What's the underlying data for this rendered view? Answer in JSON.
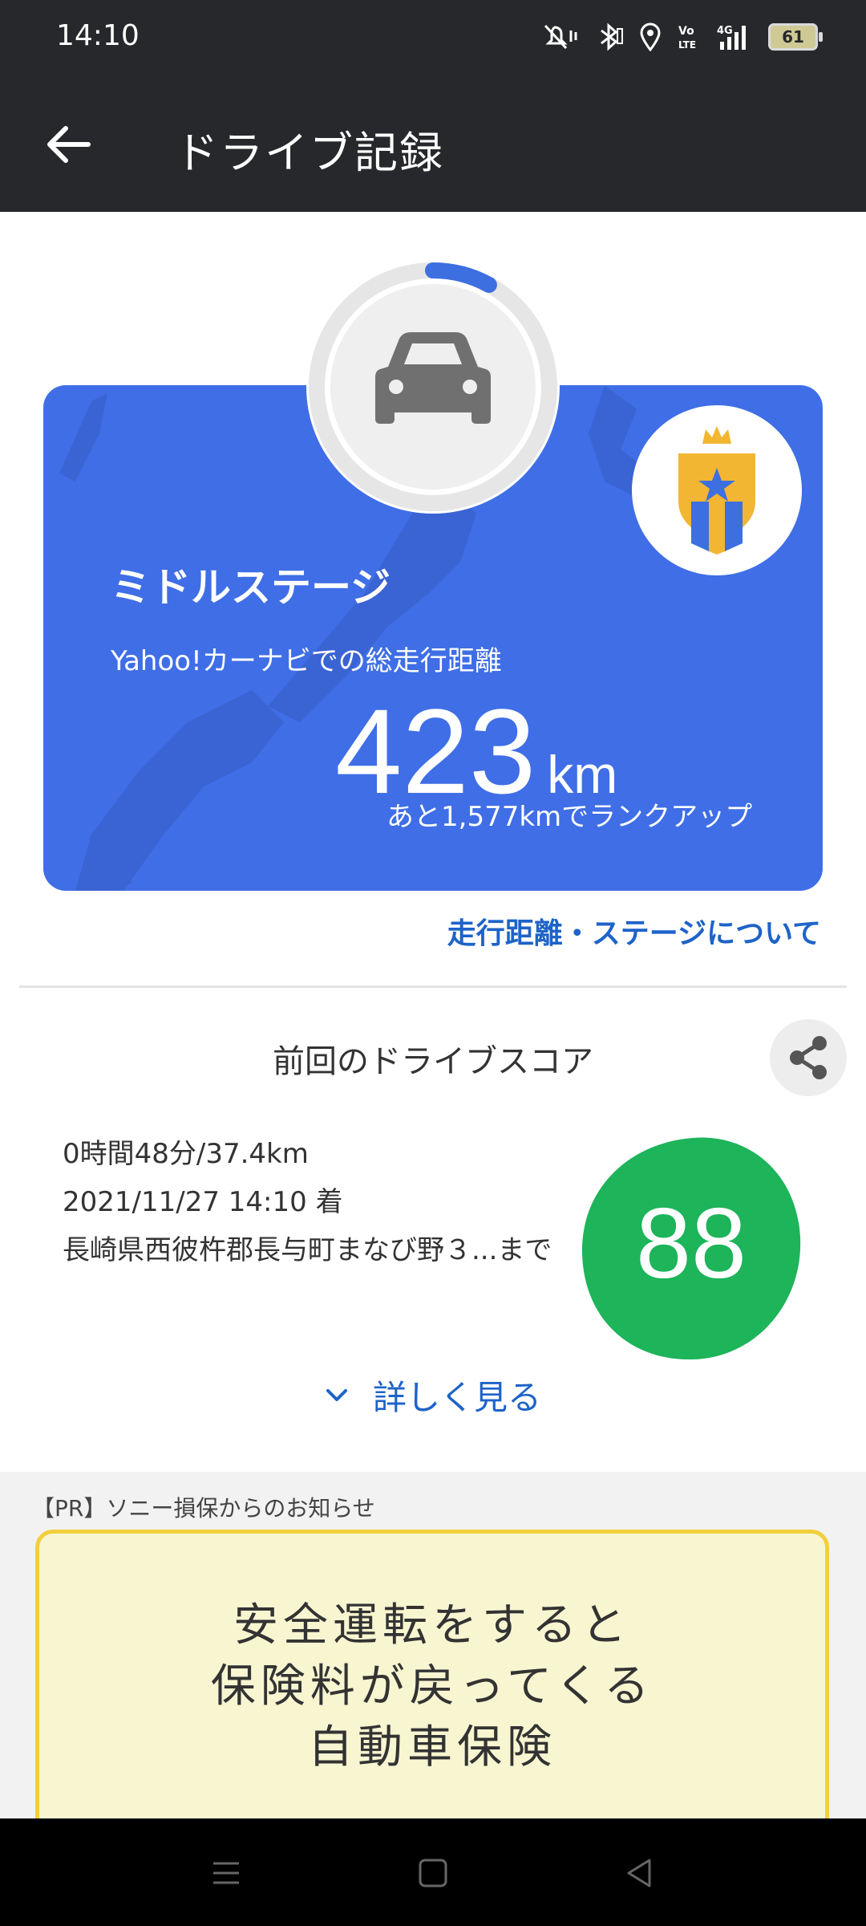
{
  "status_bar": {
    "time": "14:10",
    "network": "4G",
    "battery": "61"
  },
  "app_bar": {
    "title": "ドライブ記録"
  },
  "stage_card": {
    "stage_name": "ミドルステージ",
    "description": "Yahoo!カーナビでの総走行距離",
    "distance_value": "423",
    "distance_unit": "km",
    "rankup_text": "あと1,577kmでランクアップ",
    "progress_fraction": 0.08,
    "colors": {
      "card": "#3f6ee6",
      "progress": "#3d6fe0",
      "badge_gold": "#f2b632"
    }
  },
  "about_link": "走行距離・ステージについて",
  "last_drive": {
    "heading": "前回のドライブスコア",
    "duration_distance": "0時間48分/37.4km",
    "arrival": "2021/11/27 14:10 着",
    "destination": "長崎県西彼杵郡長与町まなび野３...まで",
    "score": "88",
    "score_color": "#1db45a",
    "details_label": "詳しく見る"
  },
  "pr": {
    "label": "【PR】ソニー損保からのお知らせ",
    "ad_lines": [
      "安全運転をすると",
      "保険料が戻ってくる",
      "自動車保険"
    ]
  }
}
